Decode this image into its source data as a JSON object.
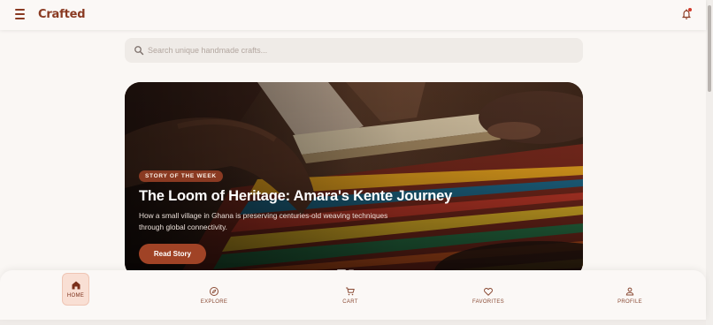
{
  "app": {
    "brand": "Crafted"
  },
  "search": {
    "placeholder": "Search unique handmade crafts...",
    "value": ""
  },
  "hero": {
    "badge": "STORY OF THE WEEK",
    "title": "The Loom of Heritage: Amara's Kente Journey",
    "description": "How a small village in Ghana is preserving centuries-old weaving techniques through global connectivity.",
    "cta": "Read Story"
  },
  "bottom_nav": {
    "active": "home",
    "items": [
      {
        "id": "home",
        "label": "HOME",
        "icon": "home-icon"
      },
      {
        "id": "explore",
        "label": "EXPLORE",
        "icon": "compass-icon"
      },
      {
        "id": "cart",
        "label": "CART",
        "icon": "cart-icon"
      },
      {
        "id": "favorites",
        "label": "FAVORITES",
        "icon": "heart-icon"
      },
      {
        "id": "profile",
        "label": "PROFILE",
        "icon": "person-icon"
      }
    ]
  },
  "colors": {
    "brand": "#8a3a22",
    "accent_button": "#a04326",
    "background": "#faf7f4",
    "nav_active_bg": "#f9dfd4",
    "notification_dot": "#d23a2a"
  }
}
